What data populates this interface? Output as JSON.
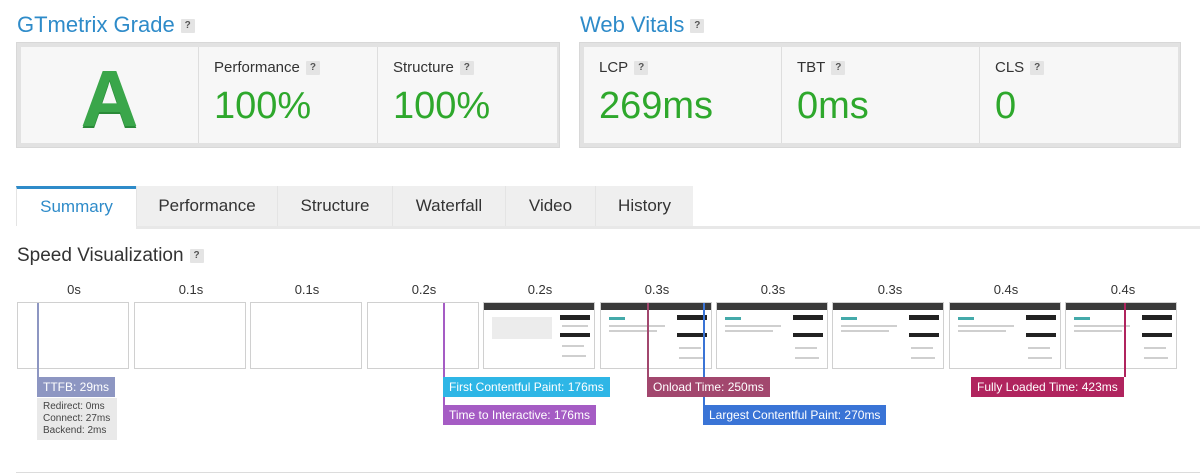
{
  "grade": {
    "title": "GTmetrix Grade",
    "help": "?",
    "letter": "A",
    "performance": {
      "label": "Performance",
      "value": "100%"
    },
    "structure": {
      "label": "Structure",
      "value": "100%"
    }
  },
  "vitals": {
    "title": "Web Vitals",
    "help": "?",
    "lcp": {
      "label": "LCP",
      "value": "269ms"
    },
    "tbt": {
      "label": "TBT",
      "value": "0ms"
    },
    "cls": {
      "label": "CLS",
      "value": "0"
    }
  },
  "tabs": [
    "Summary",
    "Performance",
    "Structure",
    "Waterfall",
    "Video",
    "History"
  ],
  "active_tab": "Summary",
  "speed": {
    "title": "Speed Visualization",
    "help": "?",
    "ticks": [
      "0s",
      "0.1s",
      "0.1s",
      "0.2s",
      "0.2s",
      "0.3s",
      "0.3s",
      "0.3s",
      "0.4s",
      "0.4s"
    ],
    "markers": {
      "ttfb": {
        "label": "TTFB: 29ms",
        "redirect": "Redirect: 0ms",
        "connect": "Connect: 27ms",
        "backend": "Backend: 2ms",
        "color": "#8d96c2"
      },
      "fcp": {
        "label": "First Contentful Paint: 176ms",
        "color": "#2eb6e6"
      },
      "tti": {
        "label": "Time to Interactive: 176ms",
        "color": "#a55cc4"
      },
      "onload": {
        "label": "Onload Time: 250ms",
        "color": "#a2476e"
      },
      "lcp": {
        "label": "Largest Contentful Paint: 270ms",
        "color": "#3a74d6"
      },
      "fully": {
        "label": "Fully Loaded Time: 423ms",
        "color": "#b0245e"
      }
    }
  },
  "colors": {
    "accent": "#2e8bc9",
    "good": "#2ea82c"
  }
}
